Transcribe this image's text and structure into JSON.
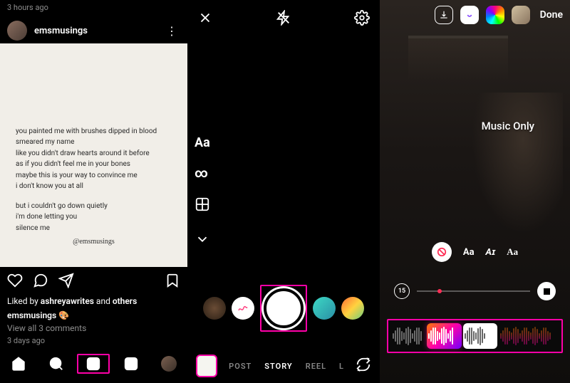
{
  "panel1": {
    "top_timestamp": "3 hours ago",
    "username": "emsmusings",
    "poem": {
      "stanza1": "you painted me with brushes dipped in blood\nsmeared my name\nlike you didn't draw hearts around it before\nas if you didn't feel me in your bones\nmaybe this is your way to convince me\ni don't know you at all",
      "stanza2": "but i couldn't go down quietly\ni'm done letting you\nsilence me",
      "signature": "@emsmusings"
    },
    "liked_by_prefix": "Liked by ",
    "liked_by_user": "ashreyawrites",
    "liked_by_suffix": " and ",
    "liked_by_others": "others",
    "caption_user": "emsmusings",
    "caption_emoji": "🎨",
    "view_comments": "View all 3 comments",
    "post_timestamp": "3 days ago"
  },
  "panel2": {
    "tools": {
      "text": "Aa",
      "infinity": "∞"
    },
    "modes": {
      "post": "POST",
      "story": "STORY",
      "reel": "REEL",
      "extra": "L"
    }
  },
  "panel3": {
    "done": "Done",
    "music_only": "Music Only",
    "styles": {
      "text": "Aa",
      "style_b": "Aɪ",
      "style_c": "Aa"
    },
    "duration": "15"
  },
  "accent": "#ff00a8"
}
